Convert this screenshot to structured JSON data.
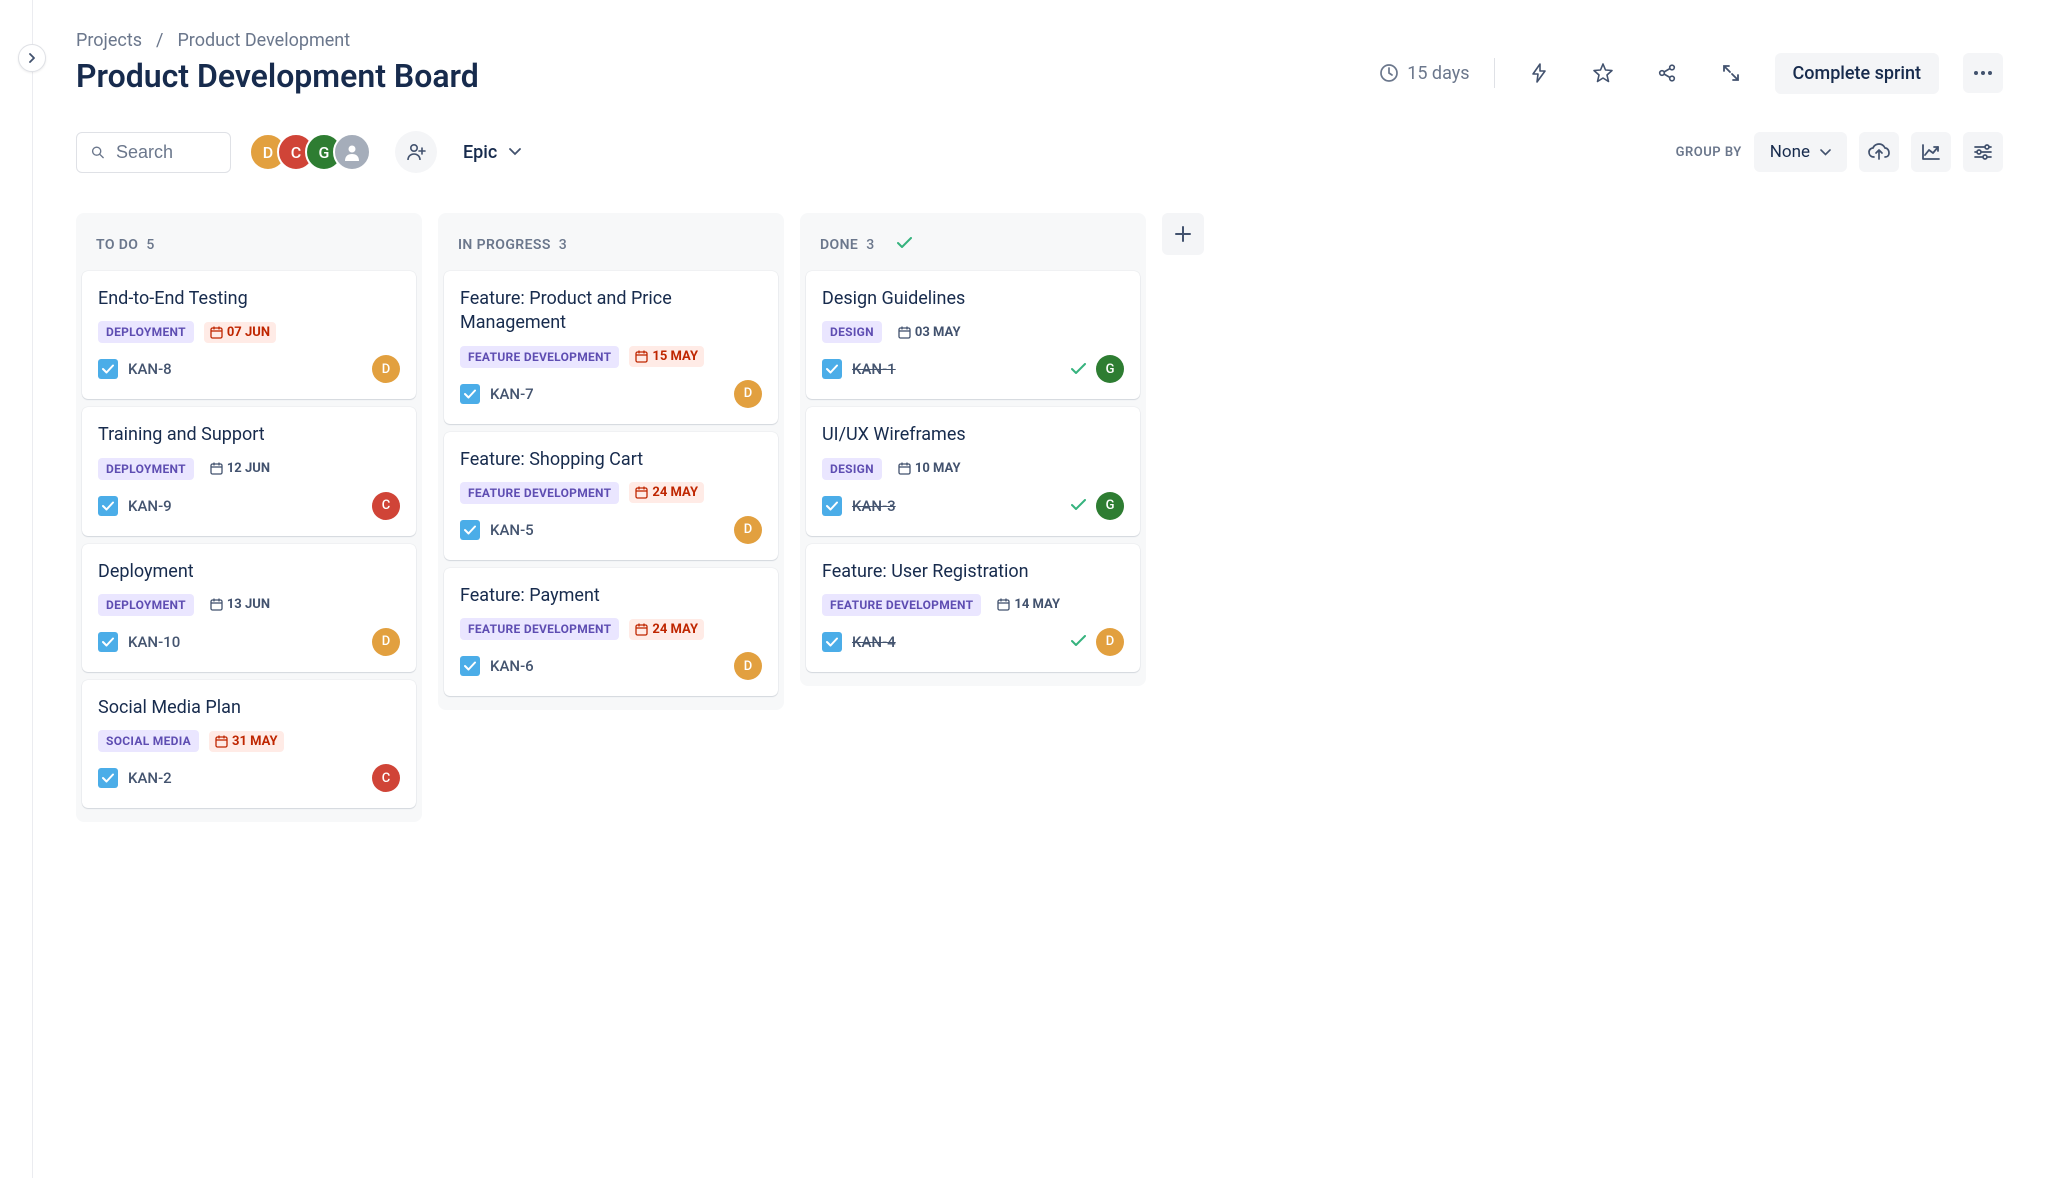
{
  "breadcrumb": {
    "root": "Projects",
    "project": "Product Development"
  },
  "page_title": "Product Development Board",
  "header": {
    "days_remaining": "15 days",
    "complete_sprint": "Complete sprint"
  },
  "search_placeholder": "Search",
  "avatars": [
    {
      "letter": "D",
      "color": "d"
    },
    {
      "letter": "C",
      "color": "c"
    },
    {
      "letter": "G",
      "color": "g"
    },
    {
      "letter": "",
      "color": "anon"
    }
  ],
  "epic_filter": "Epic",
  "group_by": {
    "label": "GROUP BY",
    "value": "None"
  },
  "columns": [
    {
      "name": "TO DO",
      "count": "5",
      "done": false,
      "cards": [
        {
          "title": "End-to-End Testing",
          "tag": "DEPLOYMENT",
          "date": "07 JUN",
          "date_style": "red",
          "key": "KAN-8",
          "assignee": "D",
          "assignee_color": "d"
        },
        {
          "title": "Training and Support",
          "tag": "DEPLOYMENT",
          "date": "12 JUN",
          "date_style": "gray",
          "key": "KAN-9",
          "assignee": "C",
          "assignee_color": "c"
        },
        {
          "title": "Deployment",
          "tag": "DEPLOYMENT",
          "date": "13 JUN",
          "date_style": "gray",
          "key": "KAN-10",
          "assignee": "D",
          "assignee_color": "d"
        },
        {
          "title": "Social Media Plan",
          "tag": "SOCIAL MEDIA",
          "date": "31 MAY",
          "date_style": "red",
          "key": "KAN-2",
          "assignee": "C",
          "assignee_color": "c"
        }
      ]
    },
    {
      "name": "IN PROGRESS",
      "count": "3",
      "done": false,
      "cards": [
        {
          "title": "Feature: Product and Price Management",
          "tag": "FEATURE DEVELOPMENT",
          "date": "15 MAY",
          "date_style": "red",
          "key": "KAN-7",
          "assignee": "D",
          "assignee_color": "d"
        },
        {
          "title": "Feature: Shopping Cart",
          "tag": "FEATURE DEVELOPMENT",
          "date": "24 MAY",
          "date_style": "red",
          "key": "KAN-5",
          "assignee": "D",
          "assignee_color": "d"
        },
        {
          "title": "Feature: Payment",
          "tag": "FEATURE DEVELOPMENT",
          "date": "24 MAY",
          "date_style": "red",
          "key": "KAN-6",
          "assignee": "D",
          "assignee_color": "d"
        }
      ]
    },
    {
      "name": "DONE",
      "count": "3",
      "done": true,
      "cards": [
        {
          "title": "Design Guidelines",
          "tag": "DESIGN",
          "date": "03 MAY",
          "date_style": "gray",
          "key": "KAN-1",
          "assignee": "G",
          "assignee_color": "g",
          "completed": true
        },
        {
          "title": "UI/UX Wireframes",
          "tag": "DESIGN",
          "date": "10 MAY",
          "date_style": "gray",
          "key": "KAN-3",
          "assignee": "G",
          "assignee_color": "g",
          "completed": true
        },
        {
          "title": "Feature: User Registration",
          "tag": "FEATURE DEVELOPMENT",
          "date": "14 MAY",
          "date_style": "gray",
          "key": "KAN-4",
          "assignee": "D",
          "assignee_color": "d",
          "completed": true
        }
      ]
    }
  ]
}
